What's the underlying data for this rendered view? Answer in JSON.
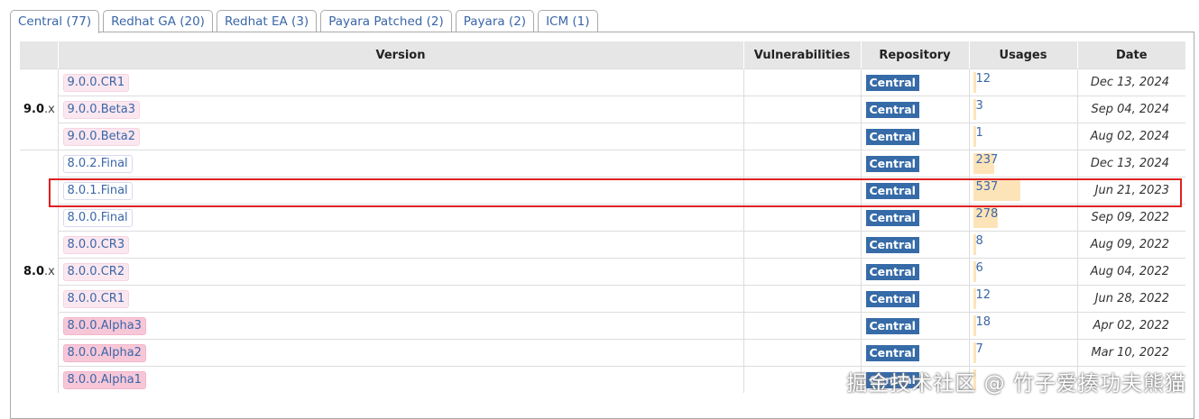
{
  "tabs": [
    {
      "label": "Central (77)",
      "active": true
    },
    {
      "label": "Redhat GA (20)",
      "active": false
    },
    {
      "label": "Redhat EA (3)",
      "active": false
    },
    {
      "label": "Payara Patched (2)",
      "active": false
    },
    {
      "label": "Payara (2)",
      "active": false
    },
    {
      "label": "ICM (1)",
      "active": false
    }
  ],
  "table": {
    "headers": {
      "version": "Version",
      "vulnerabilities": "Vulnerabilities",
      "repository": "Repository",
      "usages": "Usages",
      "date": "Date"
    },
    "groups": [
      {
        "major": "9.0",
        "suffix": ".x"
      },
      {
        "major": "8.0",
        "suffix": ".x"
      }
    ],
    "rows": [
      {
        "version": "9.0.0.CR1",
        "kind": "pre",
        "repo": "Central",
        "usages": "12",
        "usage_fraction": 0.022,
        "date": "Dec 13, 2024"
      },
      {
        "version": "9.0.0.Beta3",
        "kind": "pre",
        "repo": "Central",
        "usages": "3",
        "usage_fraction": 0.006,
        "date": "Sep 04, 2024"
      },
      {
        "version": "9.0.0.Beta2",
        "kind": "pre",
        "repo": "Central",
        "usages": "1",
        "usage_fraction": 0.002,
        "date": "Aug 02, 2024"
      },
      {
        "version": "8.0.2.Final",
        "kind": "final",
        "repo": "Central",
        "usages": "237",
        "usage_fraction": 0.44,
        "date": "Dec 13, 2024"
      },
      {
        "version": "8.0.1.Final",
        "kind": "final",
        "repo": "Central",
        "usages": "537",
        "usage_fraction": 1.0,
        "date": "Jun 21, 2023"
      },
      {
        "version": "8.0.0.Final",
        "kind": "final",
        "repo": "Central",
        "usages": "278",
        "usage_fraction": 0.52,
        "date": "Sep 09, 2022"
      },
      {
        "version": "8.0.0.CR3",
        "kind": "pre",
        "repo": "Central",
        "usages": "8",
        "usage_fraction": 0.015,
        "date": "Aug 09, 2022"
      },
      {
        "version": "8.0.0.CR2",
        "kind": "pre",
        "repo": "Central",
        "usages": "6",
        "usage_fraction": 0.011,
        "date": "Aug 04, 2022"
      },
      {
        "version": "8.0.0.CR1",
        "kind": "pre",
        "repo": "Central",
        "usages": "12",
        "usage_fraction": 0.022,
        "date": "Jun 28, 2022"
      },
      {
        "version": "8.0.0.Alpha3",
        "kind": "alpha",
        "repo": "Central",
        "usages": "18",
        "usage_fraction": 0.034,
        "date": "Apr 02, 2022"
      },
      {
        "version": "8.0.0.Alpha2",
        "kind": "alpha",
        "repo": "Central",
        "usages": "7",
        "usage_fraction": 0.013,
        "date": "Mar 10, 2022"
      },
      {
        "version": "8.0.0.Alpha1",
        "kind": "alpha",
        "repo": "Central",
        "usages": "",
        "usage_fraction": 0.01,
        "date": ""
      }
    ]
  },
  "watermark": "掘金技术社区 @ 竹子爱揍功夫熊猫",
  "colors": {
    "link": "#3a66a8",
    "repo_badge": "#366ba8",
    "usage_bar": "#fde4b8",
    "highlight": "#e02020"
  }
}
